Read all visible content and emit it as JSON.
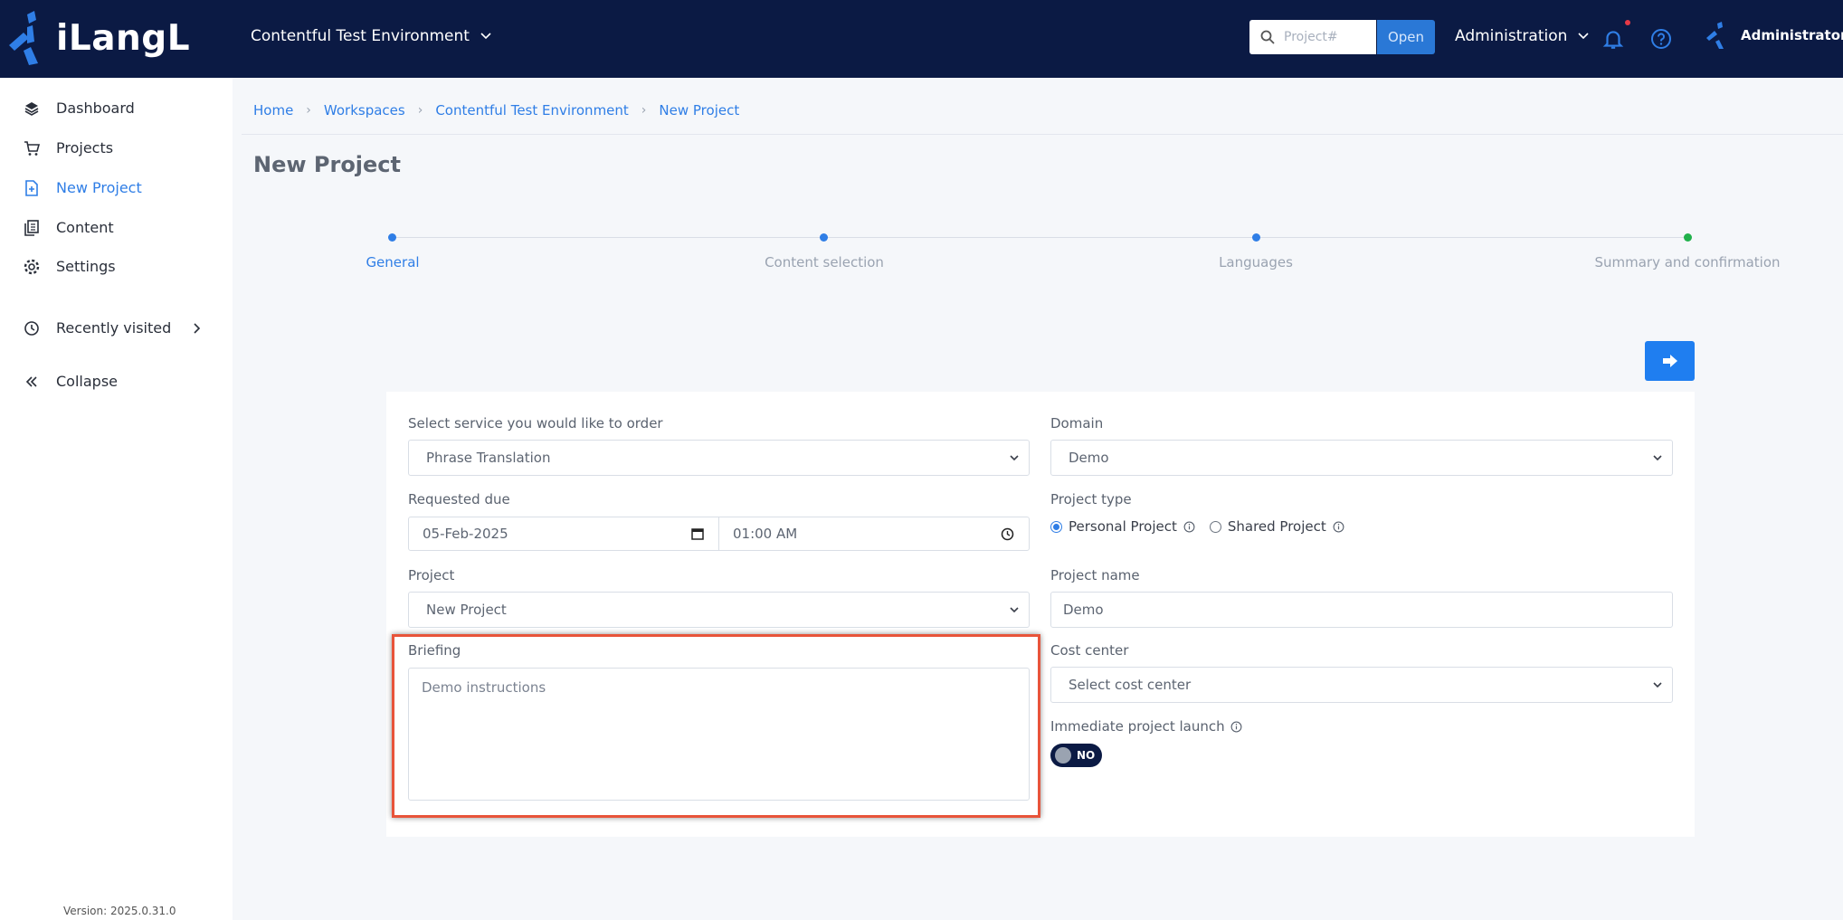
{
  "header": {
    "logo_text": "iLangL",
    "workspace": "Contentful Test Environment",
    "search_placeholder": "Project#",
    "open_label": "Open",
    "admin_menu": "Administration",
    "user_name": "Administrator"
  },
  "sidebar": {
    "items": [
      {
        "label": "Dashboard",
        "icon": "layers-icon"
      },
      {
        "label": "Projects",
        "icon": "cart-icon"
      },
      {
        "label": "New Project",
        "icon": "new-file-icon"
      },
      {
        "label": "Content",
        "icon": "documents-icon"
      },
      {
        "label": "Settings",
        "icon": "gear-icon"
      },
      {
        "label": "Recently visited",
        "icon": "history-icon"
      },
      {
        "label": "Collapse",
        "icon": "double-chevron-left-icon"
      }
    ],
    "version": "Version: 2025.0.31.0"
  },
  "breadcrumb": [
    "Home",
    "Workspaces",
    "Contentful Test Environment",
    "New Project"
  ],
  "page_title": "New Project",
  "steps": [
    "General",
    "Content selection",
    "Languages",
    "Summary and confirmation"
  ],
  "colors": {
    "accent": "#2f7ee6",
    "header_bg": "#0b1a44",
    "step_final": "#21b14b",
    "highlight": "#e8543a"
  },
  "form": {
    "service_label": "Select service you would like to order",
    "service_value": "Phrase Translation",
    "domain_label": "Domain",
    "domain_value": "Demo",
    "due_label": "Requested due",
    "due_date": "05-Feb-2025",
    "due_time": "01:00 AM",
    "project_type_label": "Project type",
    "project_type_options": [
      "Personal Project",
      "Shared Project"
    ],
    "project_label": "Project",
    "project_value": "New Project",
    "project_name_label": "Project name",
    "project_name_value": "Demo",
    "briefing_label": "Briefing",
    "briefing_value": "Demo instructions",
    "cost_center_label": "Cost center",
    "cost_center_placeholder": "Select cost center",
    "launch_label": "Immediate project launch",
    "launch_toggle": "NO"
  }
}
